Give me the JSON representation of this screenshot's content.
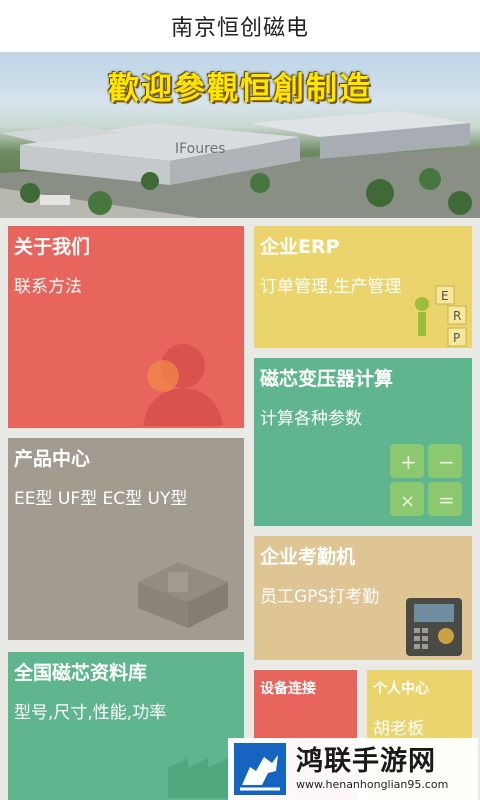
{
  "header": {
    "title": "南京恒创磁电"
  },
  "banner": {
    "text": "歡迎參觀恒創制造"
  },
  "tiles": {
    "about": {
      "title": "关于我们",
      "subtitle": "联系方法",
      "color": "#e8655d"
    },
    "erp": {
      "title": "企业ERP",
      "subtitle": "订单管理,生产管理",
      "color": "#ecd46d"
    },
    "transformer": {
      "title": "磁芯变压器计算",
      "subtitle": "计算各种参数",
      "color": "#5fb58d"
    },
    "products": {
      "title": "产品中心",
      "subtitle": "EE型 UF型 EC型 UY型",
      "color": "#a19c8f"
    },
    "attendance": {
      "title": "企业考勤机",
      "subtitle": "员工GPS打考勤",
      "color": "#e0c594"
    },
    "database": {
      "title": "全国磁芯资料库",
      "subtitle": "型号,尺寸,性能,功率",
      "color": "#5fb58d"
    },
    "device": {
      "title": "设备连接",
      "color": "#e8655d"
    },
    "personal": {
      "title": "个人中心",
      "subtitle": "胡老板",
      "color": "#ecd46d"
    }
  },
  "watermark": {
    "title": "鸿联手游网",
    "url": "www.henanhonglian95.com"
  }
}
